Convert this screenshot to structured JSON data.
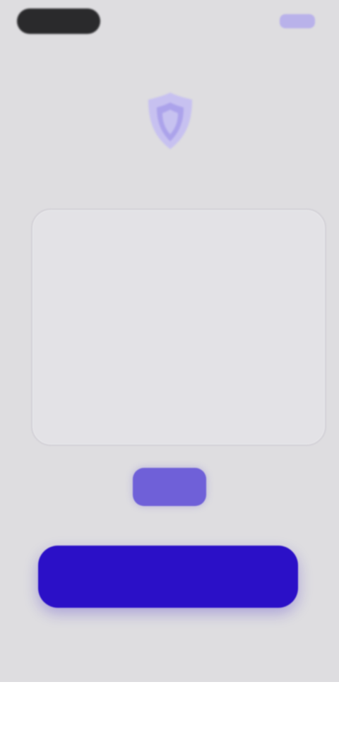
{
  "top_bar": {
    "right_action_label": ""
  },
  "hero": {
    "title": ""
  },
  "card": {
    "text": ""
  },
  "actions": {
    "small_button_label": "",
    "primary_button_label": ""
  },
  "colors": {
    "background": "#dedde0",
    "accent": "#2b10c7",
    "accent_soft": "#6f60d8",
    "accent_light": "#b3aceb"
  },
  "icons": {
    "hero": "shield-icon",
    "status_left": "status-pill"
  }
}
